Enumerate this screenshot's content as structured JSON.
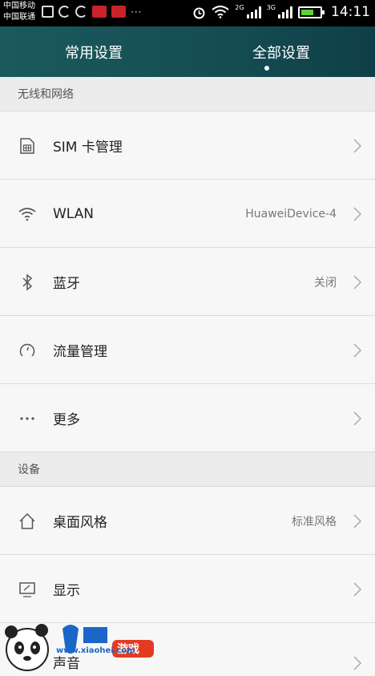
{
  "status_bar": {
    "carrier_1": "中国移动",
    "carrier_2": "中国联通",
    "net_1": "2G",
    "net_2": "3G",
    "time": "14:11"
  },
  "tabs": {
    "common": "常用设置",
    "all": "全部设置"
  },
  "sections": {
    "wireless": "无线和网络",
    "device": "设备"
  },
  "rows": [
    {
      "label": "SIM 卡管理",
      "value": "",
      "icon": "sim-card-icon"
    },
    {
      "label": "WLAN",
      "value": "HuaweiDevice-4",
      "icon": "wifi-icon"
    },
    {
      "label": "蓝牙",
      "value": "关闭",
      "icon": "bluetooth-icon"
    },
    {
      "label": "流量管理",
      "value": "",
      "icon": "data-usage-icon"
    },
    {
      "label": "更多",
      "value": "",
      "icon": "more-icon"
    },
    {
      "label": "桌面风格",
      "value": "标准风格",
      "icon": "home-icon"
    },
    {
      "label": "显示",
      "value": "",
      "icon": "display-icon"
    }
  ],
  "partial_row_label": "声音",
  "watermark": {
    "site": "www.xiaohei.com",
    "logo_text": "小黑游戏"
  },
  "colors": {
    "header_bg": "#164f55",
    "background": "#f5f5f5",
    "battery": "#5bd13a"
  }
}
